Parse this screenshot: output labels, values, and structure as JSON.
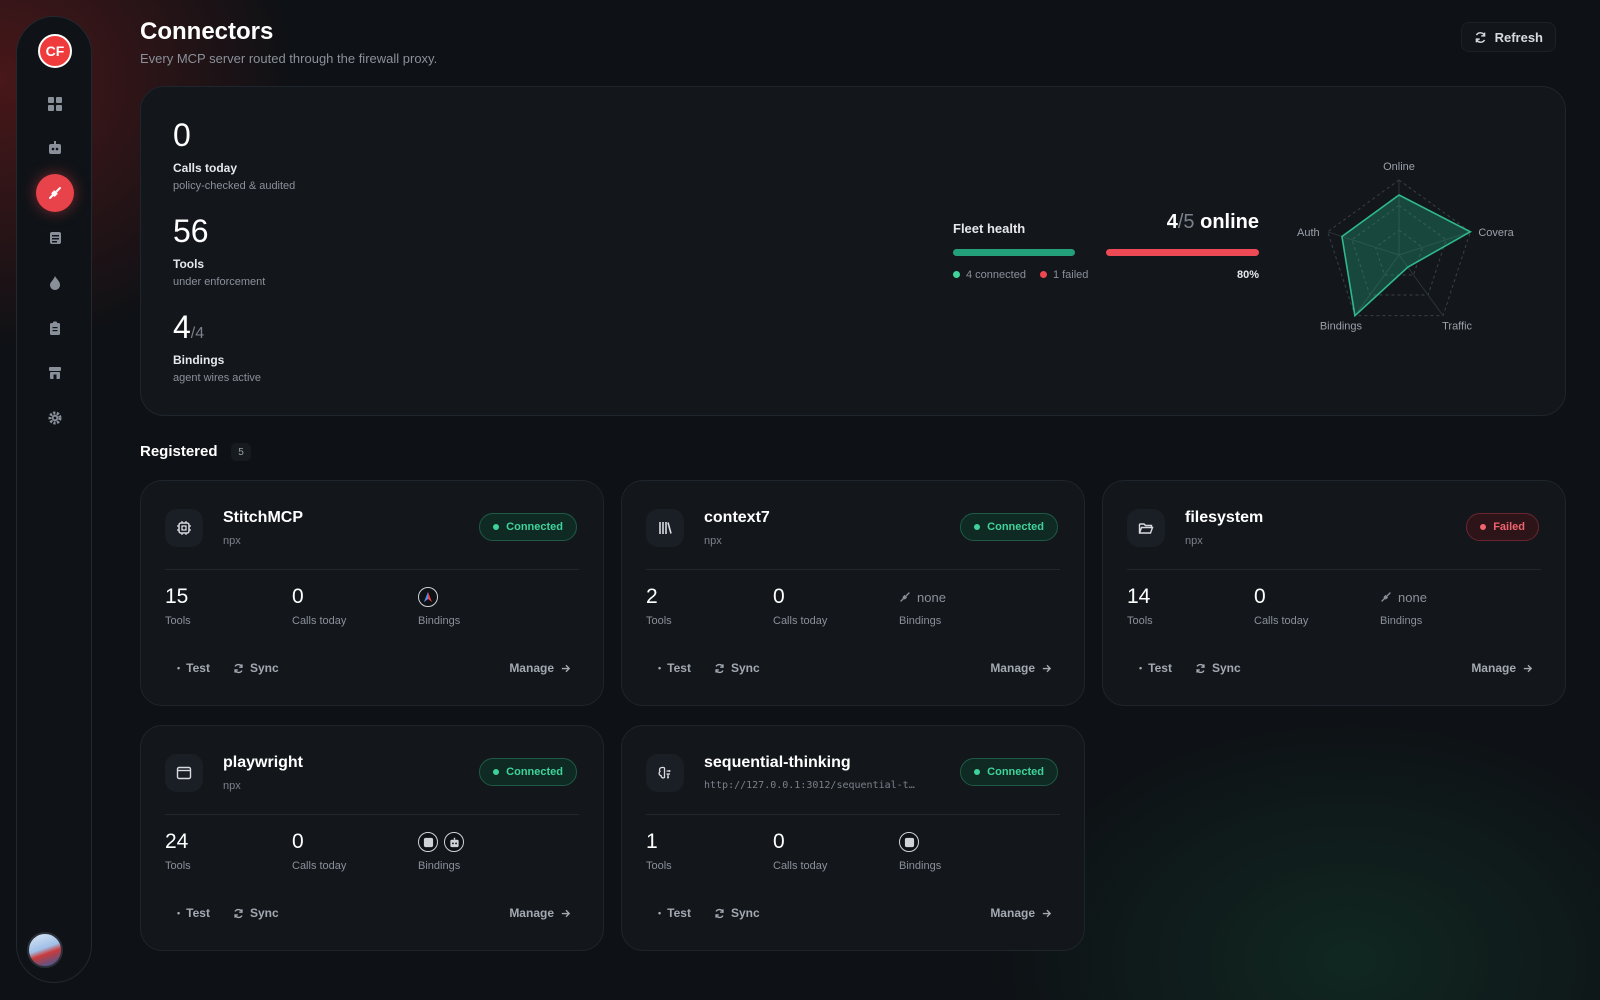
{
  "app": {
    "logo_text": "CF"
  },
  "sidebar": {
    "items": [
      {
        "icon": "dashboard-grid-icon"
      },
      {
        "icon": "robot-icon"
      },
      {
        "icon": "plug-icon",
        "active": true
      },
      {
        "icon": "scroll-icon"
      },
      {
        "icon": "flame-icon"
      },
      {
        "icon": "clipboard-icon"
      },
      {
        "icon": "store-icon"
      },
      {
        "icon": "gear-icon"
      }
    ]
  },
  "header": {
    "title": "Connectors",
    "subtitle": "Every MCP server routed through the firewall proxy.",
    "refresh_label": "Refresh"
  },
  "summary": {
    "stats": [
      {
        "value": "0",
        "sub": "",
        "label": "Calls today",
        "desc": "policy-checked & audited"
      },
      {
        "value": "56",
        "sub": "",
        "label": "Tools",
        "desc": "under enforcement"
      },
      {
        "value": "4",
        "sub": "/4",
        "label": "Bindings",
        "desc": "agent wires active"
      }
    ],
    "fleet": {
      "title": "Fleet health",
      "online": "4",
      "total": "/5",
      "online_label": " online",
      "connected_label": "4 connected",
      "failed_label": "1 failed",
      "percent": "80%",
      "health_fraction": 0.8
    },
    "radar": {
      "axes": [
        "Online",
        "Covera",
        "Traffic",
        "Bindings",
        "Auth"
      ],
      "values": [
        0.8,
        1.0,
        0.2,
        1.0,
        0.8
      ]
    }
  },
  "registered": {
    "title": "Registered",
    "count": "5"
  },
  "colors": {
    "accent": "#e8424a",
    "connected": "#3fd39b",
    "failed": "#f0646e",
    "green_bar": "#23a07a",
    "red_bar": "#ee4a55"
  },
  "cards": [
    {
      "name": "StitchMCP",
      "cmd": "npx",
      "status": "Connected",
      "tools": "15",
      "calls": "0",
      "bindings": "",
      "binding_icons": [
        "stitch-agent-icon"
      ],
      "tools_label": "Tools",
      "calls_label": "Calls today",
      "bindings_label": "Bindings",
      "test": "Test",
      "sync": "Sync",
      "manage": "Manage",
      "icon": "chip-icon"
    },
    {
      "name": "context7",
      "cmd": "npx",
      "status": "Connected",
      "tools": "2",
      "calls": "0",
      "bindings": "none",
      "binding_icons": [],
      "tools_label": "Tools",
      "calls_label": "Calls today",
      "bindings_label": "Bindings",
      "test": "Test",
      "sync": "Sync",
      "manage": "Manage",
      "icon": "library-icon"
    },
    {
      "name": "filesystem",
      "cmd": "npx",
      "status": "Failed",
      "tools": "14",
      "calls": "0",
      "bindings": "none",
      "binding_icons": [],
      "tools_label": "Tools",
      "calls_label": "Calls today",
      "bindings_label": "Bindings",
      "test": "Test",
      "sync": "Sync",
      "manage": "Manage",
      "icon": "folder-open-icon"
    },
    {
      "name": "playwright",
      "cmd": "npx",
      "status": "Connected",
      "tools": "24",
      "calls": "0",
      "bindings": "",
      "binding_icons": [
        "agent-icon",
        "robot-agent-icon"
      ],
      "tools_label": "Tools",
      "calls_label": "Calls today",
      "bindings_label": "Bindings",
      "test": "Test",
      "sync": "Sync",
      "manage": "Manage",
      "icon": "browser-window-icon"
    },
    {
      "name": "sequential-thinking",
      "cmd": "http://127.0.0.1:3012/sequential-t…",
      "status": "Connected",
      "tools": "1",
      "calls": "0",
      "bindings": "",
      "binding_icons": [
        "agent-icon"
      ],
      "tools_label": "Tools",
      "calls_label": "Calls today",
      "bindings_label": "Bindings",
      "test": "Test",
      "sync": "Sync",
      "manage": "Manage",
      "icon": "brain-icon"
    }
  ]
}
